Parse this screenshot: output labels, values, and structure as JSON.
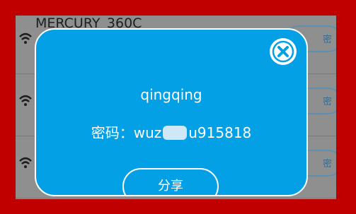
{
  "background_list": {
    "rows": [
      {
        "ssid": "MERCURY_360C",
        "button": "密"
      },
      {
        "ssid": "",
        "button": "密"
      },
      {
        "ssid": "",
        "button": "密"
      }
    ]
  },
  "dialog": {
    "wifi_name": "qingqing",
    "password_label": "密码：",
    "password_prefix": "wuz",
    "password_suffix": "u915818",
    "share_label": "分享"
  },
  "colors": {
    "frame": "#c00000",
    "dialog_bg": "#04a0e6",
    "overlay": "#8f8f8f"
  }
}
